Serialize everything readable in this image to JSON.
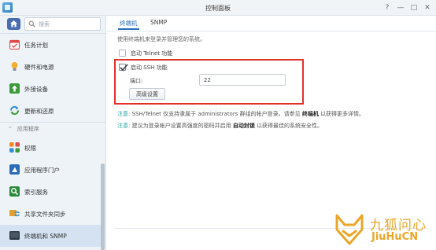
{
  "window": {
    "title": "控制面板",
    "controls": [
      "?",
      "—",
      "□",
      "✕"
    ]
  },
  "sidebar": {
    "search_placeholder": "搜索",
    "section_label": "应用程序",
    "items": [
      {
        "label": "任务计划",
        "icon": "calendar-icon",
        "color": "#e04a4a"
      },
      {
        "label": "硬件和电源",
        "icon": "bulb-icon",
        "color": "#f2b02c"
      },
      {
        "label": "外接设备",
        "icon": "upload-icon",
        "color": "#3a9a3a"
      },
      {
        "label": "更新和还原",
        "icon": "refresh-icon",
        "color": "#2e8fd3"
      },
      {
        "label": "权限",
        "icon": "grid-icon",
        "color": "#f08a1c"
      },
      {
        "label": "应用程序门户",
        "icon": "portal-icon",
        "color": "#2b6cb8"
      },
      {
        "label": "索引服务",
        "icon": "index-icon",
        "color": "#2a8a3a"
      },
      {
        "label": "共享文件夹同步",
        "icon": "sync-icon",
        "color": "#e0a030"
      },
      {
        "label": "终端机和 SNMP",
        "icon": "terminal-icon",
        "color": "#2f3a45"
      }
    ]
  },
  "tabs": [
    "终端机",
    "SNMP"
  ],
  "main": {
    "description": "使用终端机来登录并管理您的系统。",
    "telnet_label": "启动 Telnet 功能",
    "ssh_label": "启动 SSH 功能",
    "port_label": "端口:",
    "port_value": "22",
    "advanced_button": "高级设置",
    "note1_prefix": "注意:",
    "note1_text": "SSH/Telnet 仅支持隶属于 administrators 群组的帐户登录。请参见",
    "note1_bold": "终端机",
    "note1_suffix": "以获得更多详情。",
    "note2_prefix": "注意:",
    "note2_text": "建议为登录帐户设置高强度的密码并启用",
    "note2_bold": "自动封锁",
    "note2_suffix": "以获得最佳的系统安全性。"
  },
  "watermark": {
    "text": "九狐问心",
    "sub": "JiuHuCN"
  },
  "colors": {
    "accent": "#2b6cb8",
    "highlight_border": "#e0312f",
    "note_color": "#2aa3a0"
  }
}
